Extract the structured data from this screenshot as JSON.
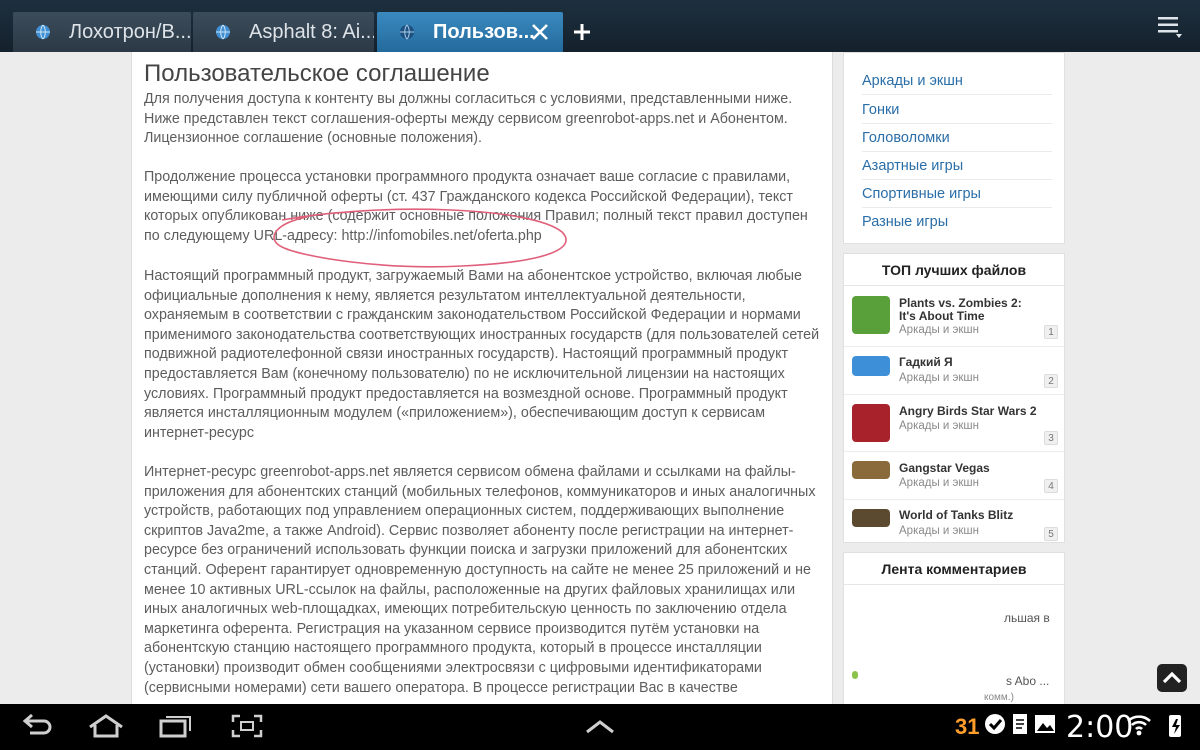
{
  "tabs": [
    {
      "label": "Лохотрон/В...",
      "active": false
    },
    {
      "label": "Asphalt 8: Ai...",
      "active": false
    },
    {
      "label": "Пользов...",
      "active": true
    }
  ],
  "article": {
    "title": "Пользовательское соглашение",
    "paragraphs": [
      "Для получения доступа к контенту вы должны согласиться с условиями, представленными ниже. Ниже представлен текст соглашения-оферты между сервисом greenrobot-apps.net и Абонентом. Лицензионное соглашение (основные положения).",
      "Продолжение процесса установки программного продукта означает ваше согласие с правилами, имеющими силу публичной оферты (ст. 437 Гражданского кодекса Российской Федерации), текст которых опубликован ниже (содержит основные положения Правил; полный текст правил доступен по следующему URL-адресу: http://infomobiles.net/oferta.php",
      "Настоящий программный продукт, загружаемый Вами на абонентское устройство, включая любые официальные дополнения к нему, является результатом интеллектуальной деятельности, охраняемым в соответствии с гражданским законодательством Российской Федерации и нормами применимого законодательства соответствующих иностранных государств (для пользователей сетей подвижной радиотелефонной связи иностранных государств). Настоящий программный продукт предоставляется Вам (конечному пользователю) по не исключительной лицензии на настоящих условиях. Программный продукт предоставляется на возмездной основе. Программный продукт является инсталляционным модулем («приложением»), обеспечивающим доступ к сервисам интернет-ресурс",
      "Интернет-ресурс greenrobot-apps.net является сервисом обмена файлами и ссылками на файлы-приложения для абонентских станций (мобильных телефонов, коммуникаторов и иных аналогичных устройств, работающих под управлением операционных систем, поддерживающих выполнение скриптов Java2me, а также Android). Сервис позволяет абоненту после регистрации на интернет-ресурсе без ограничений использовать функции поиска и загрузки приложений для абонентских станций. Оферент гарантирует одновременную доступность на сайте не менее 25 приложений и не менее 10 активных URL-ссылок на файлы, расположенные на других файловых хранилищах или иных аналогичных web-площадках, имеющих потребительскую ценность по заключению отдела маркетинга оферента. Регистрация на указанном сервисе производится путём установки на абонентскую станцию настоящего программного продукта, который в процессе инсталляции (установки) производит обмен сообщениями электросвязи с цифровыми идентификаторами (сервисными номерами) сети вашего оператора. В процессе регистрации Вас в качестве"
    ]
  },
  "sidebar": {
    "categories": [
      "Аркады и экшн",
      "Гонки",
      "Головоломки",
      "Азартные игры",
      "Спортивные игры",
      "Разные игры"
    ],
    "top_title": "ТОП лучших файлов",
    "top_files": [
      {
        "name": "Plants vs. Zombies 2: It's About Time",
        "category": "Аркады и экшн",
        "rank": "1",
        "color": "#5aa03a"
      },
      {
        "name": "Гадкий Я",
        "category": "Аркады и экшн",
        "rank": "2",
        "color": "#3d8fd8"
      },
      {
        "name": "Angry Birds Star Wars 2",
        "category": "Аркады и экшн",
        "rank": "3",
        "color": "#a8222c"
      },
      {
        "name": "Gangstar Vegas",
        "category": "Аркады и экшн",
        "rank": "4",
        "color": "#8a6a3a"
      },
      {
        "name": "World of Tanks Blitz",
        "category": "Аркады и экшн",
        "rank": "5",
        "color": "#5c4a30"
      }
    ],
    "comments_title": "Лента комментариев",
    "comment_fragments": [
      "льшая в",
      "s Abo ...",
      "комм.)"
    ]
  },
  "system": {
    "clock": "2:00",
    "calendar_badge": "31"
  }
}
